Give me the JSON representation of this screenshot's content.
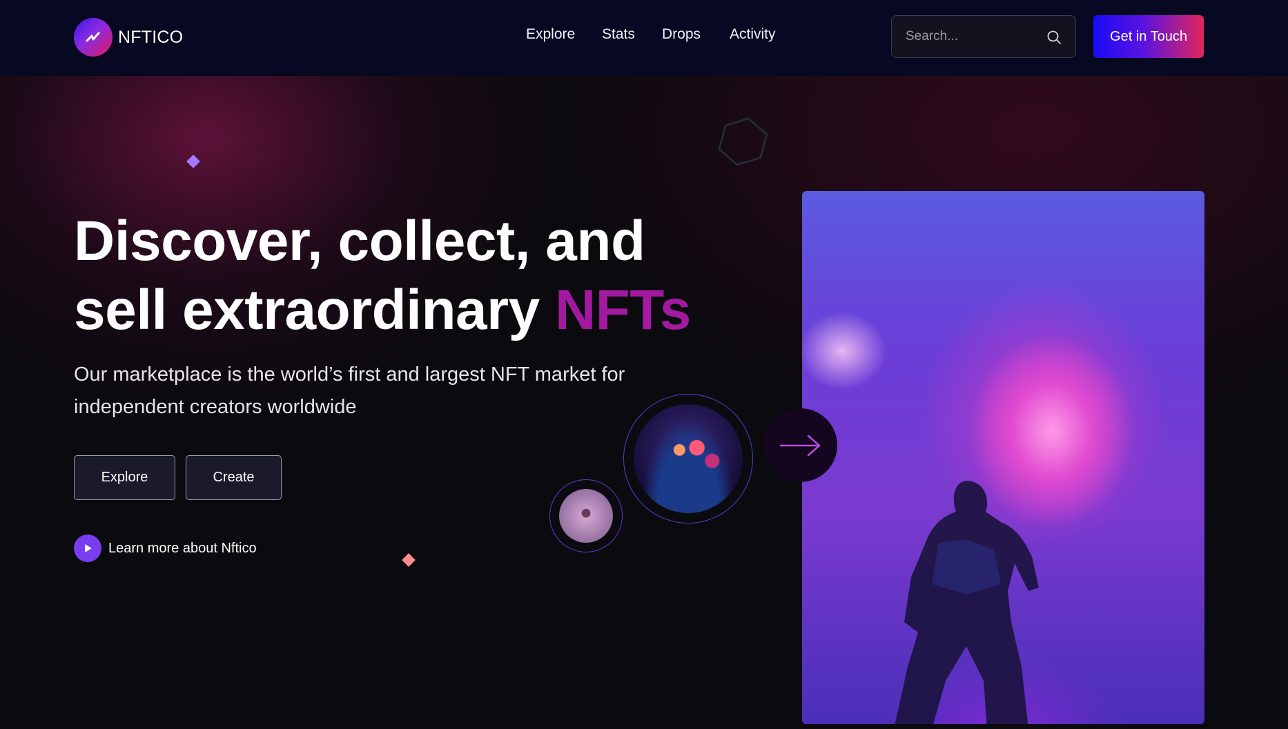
{
  "brand": {
    "name": "NFTICO"
  },
  "nav": {
    "items": [
      "Explore",
      "Stats",
      "Drops",
      "Activity"
    ]
  },
  "search": {
    "placeholder": "Search...",
    "value": "",
    "icon": "search-icon"
  },
  "header": {
    "cta_label": "Get in Touch"
  },
  "hero": {
    "headline_line1": "Discover, collect, and",
    "headline_line2": "sell extraordinary",
    "headline_accent": "NFTs",
    "subtitle": "Our marketplace is the world’s first and largest NFT market for independent creators worldwide",
    "explore_label": "Explore",
    "create_label": "Create",
    "learn_more": "Learn more about Nftico"
  },
  "colors": {
    "header_bg": "#070821",
    "accent": "#a31aa0",
    "cta_gradient_start": "#1a0cf5",
    "cta_gradient_end": "#e2265c",
    "play_button": "#7a3cf0"
  }
}
